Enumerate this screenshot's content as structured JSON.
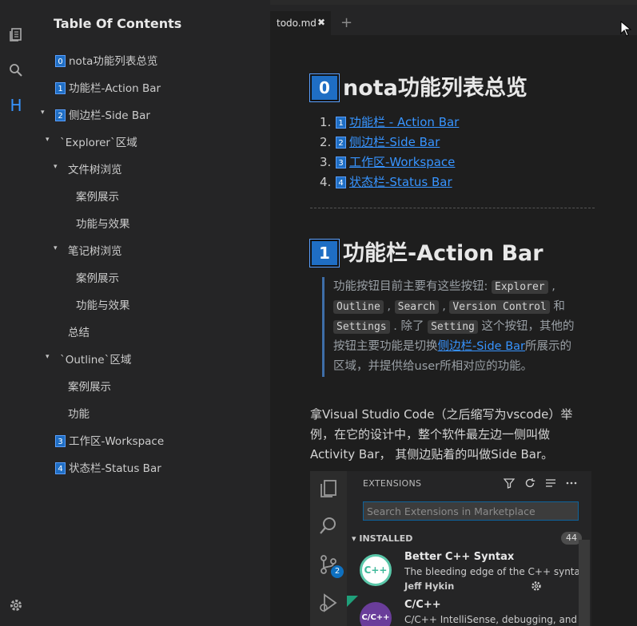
{
  "colors": {
    "accent": "#3794ff",
    "badge": "#1f6ec4",
    "bg": "#1e1e1e",
    "sidebar_bg": "#252526"
  },
  "activity_bar": {
    "icons": [
      "files-icon",
      "search-icon",
      "heading-icon",
      "gear-icon"
    ],
    "heading_glyph": "H"
  },
  "sidebar": {
    "title": "Table Of Contents",
    "items": [
      {
        "badge": "0",
        "text": "nota功能列表总览",
        "level": 0,
        "arrow": ""
      },
      {
        "badge": "1",
        "text": "功能栏-Action Bar",
        "level": 0,
        "arrow": ""
      },
      {
        "badge": "2",
        "text": "侧边栏-Side Bar",
        "level": 0,
        "arrow": "▾"
      },
      {
        "badge": "",
        "text": "`Explorer`区域",
        "level": 1,
        "arrow": "▾"
      },
      {
        "badge": "",
        "text": "文件树浏览",
        "level": 2,
        "arrow": "▾"
      },
      {
        "badge": "",
        "text": "案例展示",
        "level": 3,
        "arrow": ""
      },
      {
        "badge": "",
        "text": "功能与效果",
        "level": 3,
        "arrow": ""
      },
      {
        "badge": "",
        "text": "笔记树浏览",
        "level": 2,
        "arrow": "▾"
      },
      {
        "badge": "",
        "text": "案例展示",
        "level": 3,
        "arrow": ""
      },
      {
        "badge": "",
        "text": "功能与效果",
        "level": 3,
        "arrow": ""
      },
      {
        "badge": "",
        "text": "总结",
        "level": 2,
        "arrow": ""
      },
      {
        "badge": "",
        "text": "`Outline`区域",
        "level": 1,
        "arrow": "▾"
      },
      {
        "badge": "",
        "text": "案例展示",
        "level": 2,
        "arrow": ""
      },
      {
        "badge": "",
        "text": "功能",
        "level": 2,
        "arrow": ""
      },
      {
        "badge": "3",
        "text": "工作区-Workspace",
        "level": 0,
        "arrow": ""
      },
      {
        "badge": "4",
        "text": "状态栏-Status Bar",
        "level": 0,
        "arrow": ""
      }
    ]
  },
  "tabs": {
    "active_label": "todo.md",
    "close_glyph": "✖",
    "add_glyph": "+"
  },
  "doc": {
    "h1a": {
      "badge": "0",
      "text": "nota功能列表总览"
    },
    "list": [
      {
        "num": "1.",
        "badge": "1",
        "text": "功能栏 - Action Bar"
      },
      {
        "num": "2.",
        "badge": "2",
        "text": "侧边栏-Side Bar"
      },
      {
        "num": "3.",
        "badge": "3",
        "text": "工作区-Workspace"
      },
      {
        "num": "4.",
        "badge": "4",
        "text": "状态栏-Status Bar"
      }
    ],
    "h1b": {
      "badge": "1",
      "text": "功能栏-Action Bar"
    },
    "quote": {
      "t1": "功能按钮目前主要有这些按钮: ",
      "c1": "Explorer",
      "t2": " , ",
      "c2": "Outline",
      "t3": " , ",
      "c3": "Search",
      "t4": " , ",
      "c4": "Version Control",
      "t5": " 和 ",
      "c5": "Settings",
      "t6": " . 除了 ",
      "c6": "Setting",
      "t7": " 这个按钮，其他的按钮主要功能是切换",
      "link": "侧边栏-Side Bar",
      "t8": "所展示的区域，并提供给user所相对应的功能。"
    },
    "paragraph": "拿Visual Studio Code（之后缩写为vscode）举例，在它的设计中，整个软件最左边一侧叫做Activity Bar， 其侧边贴着的叫做Side Bar。"
  },
  "embed": {
    "title": "EXTENSIONS",
    "search_placeholder": "Search Extensions in Marketplace",
    "installed_label": "INSTALLED",
    "installed_count": "44",
    "scm_badge": "2",
    "extensions": [
      {
        "name": "Better C++ Syntax",
        "desc": "The bleeding edge of the C++ syntax",
        "author": "Jeff Hykin",
        "logo_text": "C++"
      },
      {
        "name": "C/C++",
        "desc": "C/C++ IntelliSense, debugging, and",
        "author": "",
        "logo_text": "C/C++"
      }
    ]
  }
}
